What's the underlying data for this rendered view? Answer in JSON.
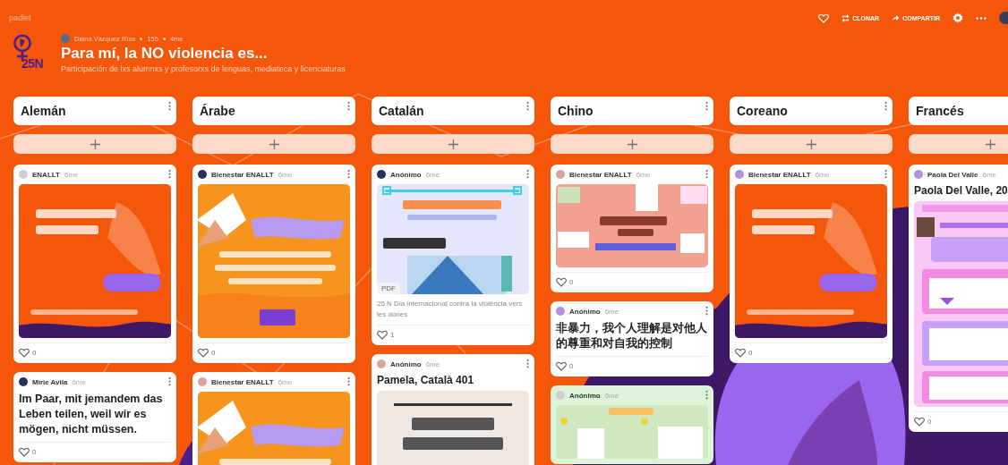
{
  "app": {
    "name": "padlet"
  },
  "actions": [
    {
      "kind": "like"
    },
    {
      "kind": "clone",
      "label": "CLONAR"
    },
    {
      "kind": "share",
      "label": "COMPARTIR"
    },
    {
      "kind": "settings"
    },
    {
      "kind": "more"
    }
  ],
  "board": {
    "logo_text": "25N",
    "author": "Diana Vázquez Ríos",
    "count": "155",
    "age": "4me",
    "title": "Para mí, la NO violencia es...",
    "description": "Participación de lxs alumnxs y profesorxs de lenguas, mediateca y licenciaturas"
  },
  "columns": [
    {
      "title": "Alemán",
      "posts": [
        {
          "author": "ENALLT",
          "age": "6me",
          "likes": "0"
        },
        {
          "author": "Mirie Avila",
          "age": "6me",
          "text": "Im Paar, mit jemandem das Leben teilen, weil wir es mögen, nicht müssen.",
          "likes": "0"
        }
      ]
    },
    {
      "title": "Árabe",
      "posts": [
        {
          "author": "Bienestar ENALLT",
          "age": "6me",
          "likes": "0"
        },
        {
          "author": "Bienestar ENALLT",
          "age": "6me"
        }
      ]
    },
    {
      "title": "Catalán",
      "posts": [
        {
          "author": "Anónimo",
          "age": "6me",
          "image": {
            "kind": "picture",
            "badge": "PDF"
          },
          "caption": "25 N Dia internacional contra la violència vers les dones",
          "likes": "1"
        },
        {
          "author": "Anónimo",
          "age": "6me",
          "title": "Pamela, Català 401"
        }
      ]
    },
    {
      "title": "Chino",
      "posts": [
        {
          "author": "Bienestar ENALLT",
          "age": "6me",
          "likes": "0"
        },
        {
          "author": "Anónimo",
          "age": "6me",
          "text": "非暴力，我个人理解是对他人的尊重和对自我的控制",
          "likes": "0"
        },
        {
          "author": "Anónimo",
          "age": "6me",
          "color": "#dcf5d8"
        }
      ]
    },
    {
      "title": "Coreano",
      "posts": [
        {
          "author": "Bienestar ENALLT",
          "age": "6me",
          "likes": "0"
        }
      ]
    },
    {
      "title": "Francés",
      "posts": [
        {
          "author": "Paola Del Valle",
          "age": "6me",
          "title": "Paola Del Valle, 20",
          "likes": "0"
        }
      ]
    }
  ]
}
